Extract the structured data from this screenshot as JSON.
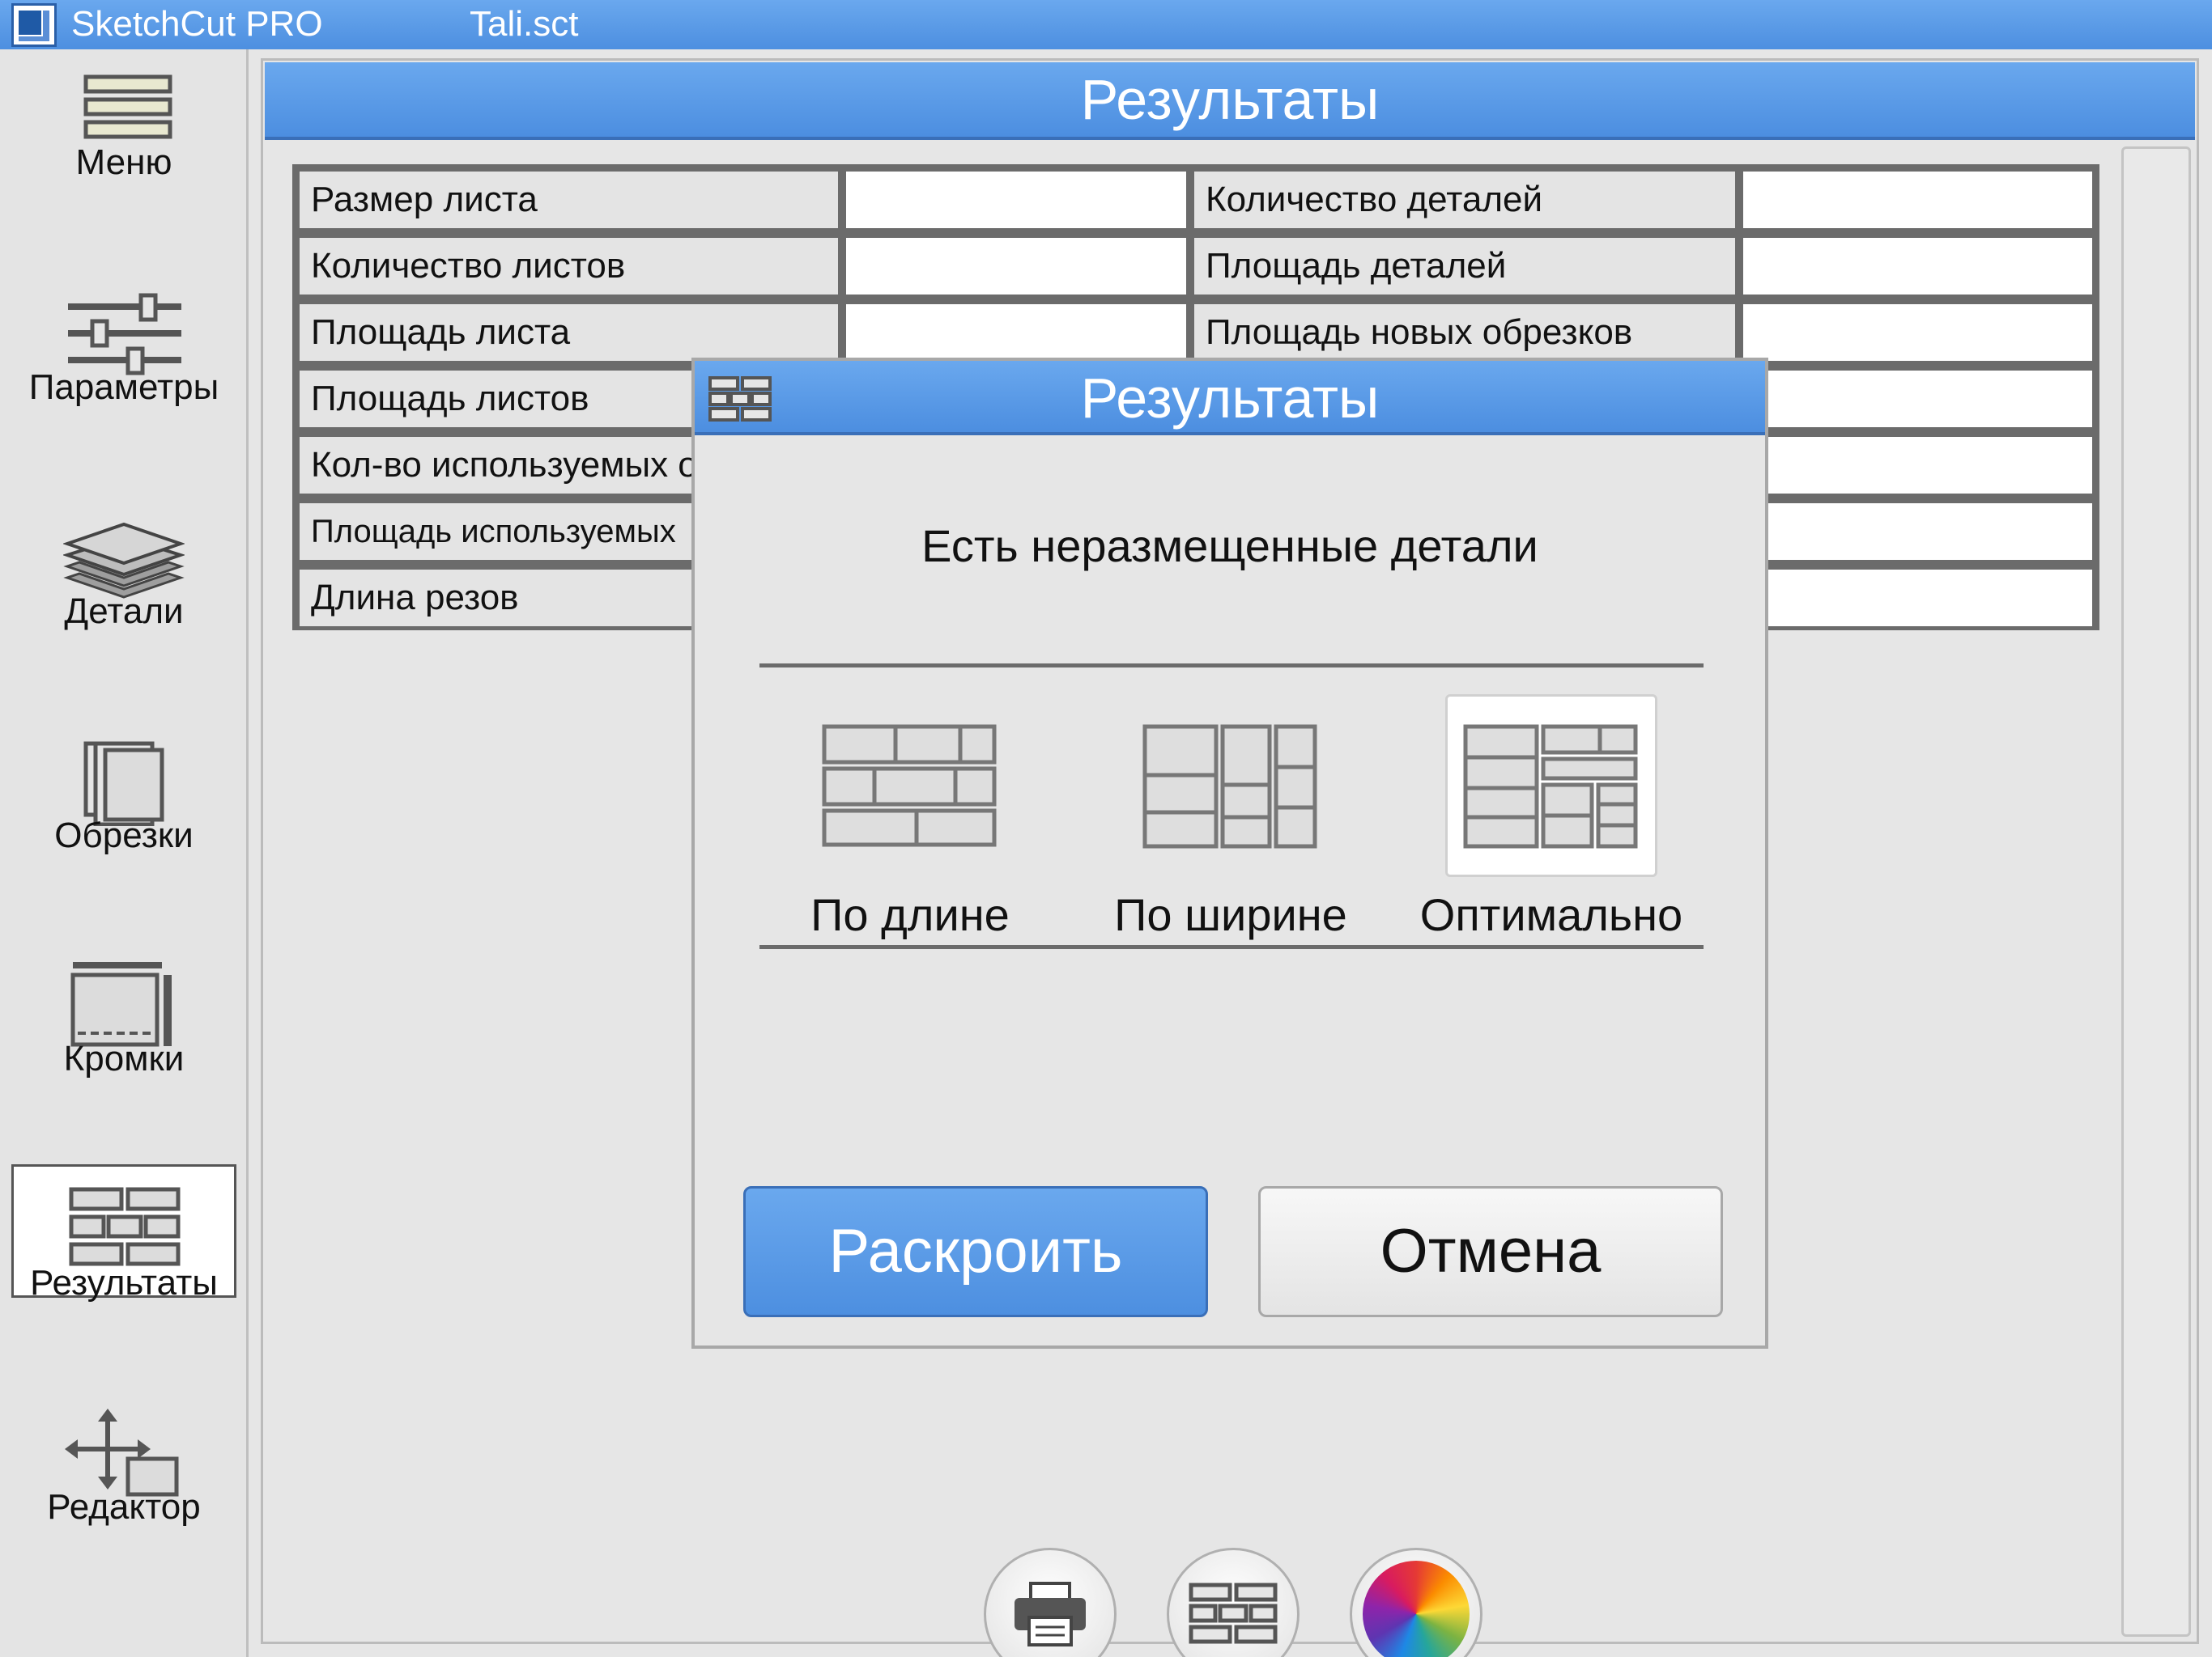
{
  "titlebar": {
    "app_title": "SketchCut PRO",
    "file_name": "Tali.sct"
  },
  "sidebar": {
    "items": [
      {
        "label": "Меню",
        "icon": "menu-icon"
      },
      {
        "label": "Параметры",
        "icon": "sliders-icon"
      },
      {
        "label": "Детали",
        "icon": "layers-icon"
      },
      {
        "label": "Обрезки",
        "icon": "offcuts-icon"
      },
      {
        "label": "Кромки",
        "icon": "edges-icon"
      },
      {
        "label": "Результаты",
        "icon": "results-grid-icon",
        "active": true
      },
      {
        "label": "Редактор",
        "icon": "move-arrows-icon"
      }
    ]
  },
  "main": {
    "header": "Результаты",
    "table": {
      "left_labels": [
        "Размер листа",
        "Количество листов",
        "Площадь листа",
        "Площадь листов",
        "Кол-во используемых о",
        "Площадь используемых",
        "Длина резов"
      ],
      "right_labels": [
        "Количество деталей",
        "Площадь деталей",
        "Площадь новых обрезков",
        "",
        "",
        "",
        ""
      ]
    }
  },
  "dialog": {
    "title": "Результаты",
    "message": "Есть неразмещенные детали",
    "options": [
      {
        "label": "По длине",
        "selected": false
      },
      {
        "label": "По ширине",
        "selected": false
      },
      {
        "label": "Оптимально",
        "selected": true
      }
    ],
    "cut_button": "Раскроить",
    "cancel_button": "Отмена"
  },
  "bottom_buttons": [
    "print-icon",
    "cutting-map-icon",
    "color-wheel-icon"
  ],
  "colors": {
    "accent": "#4d8fe0",
    "accent_dark": "#3a6fb8",
    "panel_bg": "#e6e6e6",
    "grid_line": "#6b6b6b"
  }
}
